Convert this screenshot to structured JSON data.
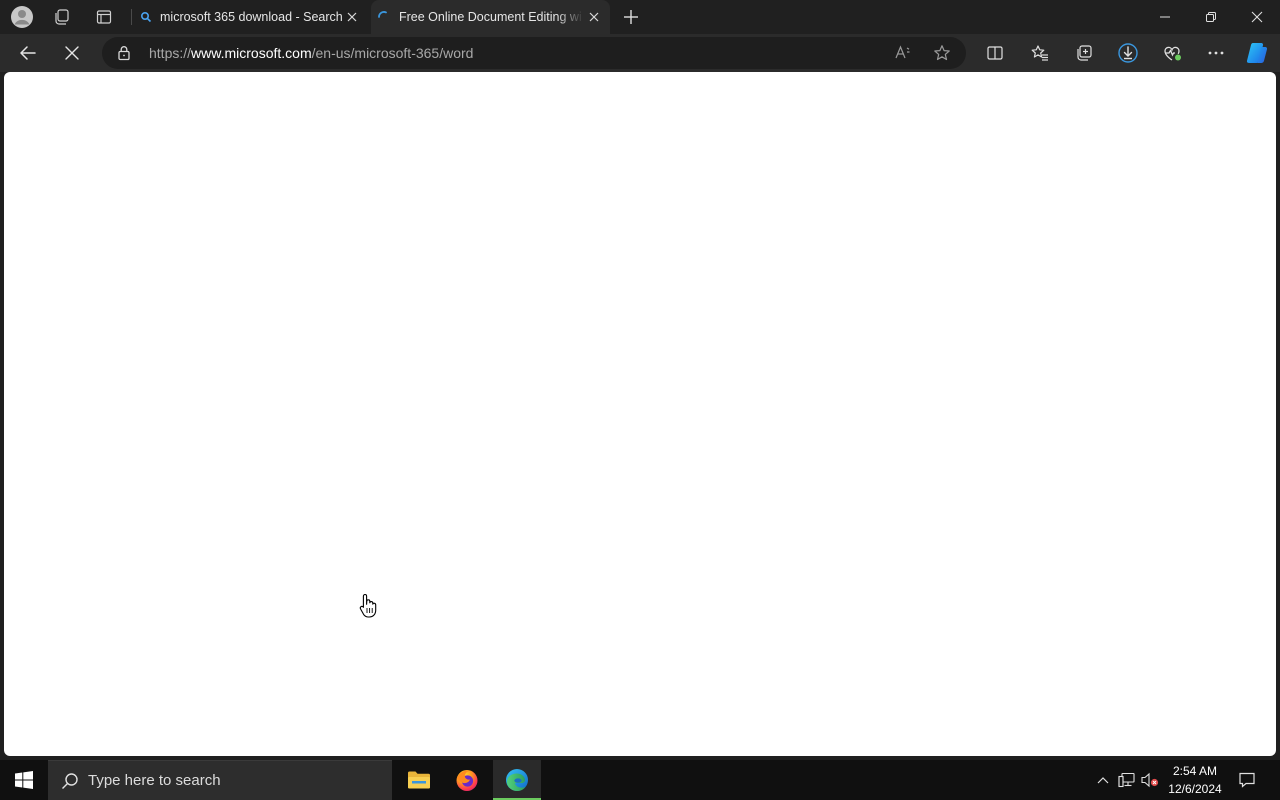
{
  "browser": {
    "tabs": [
      {
        "title": "microsoft 365 download - Search",
        "icon": "search-icon",
        "active": false
      },
      {
        "title": "Free Online Document Editing wi",
        "icon": "loading-spinner-icon",
        "active": true
      }
    ],
    "address": {
      "url_prefix": "https://",
      "url_host": "www.microsoft.com",
      "url_path": "/en-us/microsoft-365/word"
    }
  },
  "page": {
    "state": "loading"
  },
  "taskbar": {
    "search_placeholder": "Type here to search",
    "apps": [
      "file-explorer-icon",
      "firefox-icon",
      "edge-icon"
    ],
    "active_app": "edge-icon",
    "time": "2:54 AM",
    "date": "12/6/2024"
  },
  "colors": {
    "accent": "#3a96dd",
    "content_bg": "#ffffff",
    "chrome_bg": "#202020"
  }
}
